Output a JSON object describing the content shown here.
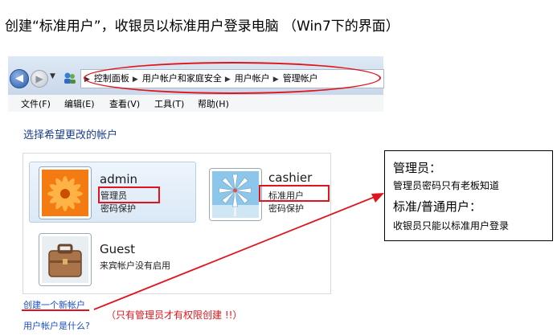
{
  "title": "创建“标准用户”，收银员以标准用户登录电脑 （Win7下的界面）",
  "address_bar": {
    "breadcrumbs": [
      "控制面板",
      "用户帐户和家庭安全",
      "用户帐户",
      "管理帐户"
    ]
  },
  "menu": [
    "文件(F)",
    "编辑(E)",
    "查看(V)",
    "工具(T)",
    "帮助(H)"
  ],
  "prompt": "选择希望更改的帐户",
  "accounts": [
    {
      "name": "admin",
      "role": "管理员",
      "password": "密码保护"
    },
    {
      "name": "cashier",
      "role": "标准用户",
      "password": "密码保护"
    },
    {
      "name": "Guest",
      "role": "来宾帐户没有启用"
    }
  ],
  "links": {
    "create": "创建一个新帐户",
    "what": "用户帐户是什么?"
  },
  "annotation_note": "（只有管理员才有权限创建 !!）",
  "callout": {
    "admin_title": "管理员：",
    "admin_desc": "管理员密码只有老板知道",
    "std_title": "标准/普通用户：",
    "std_desc": "收银员只能以标准用户登录"
  },
  "colors": {
    "annotation_red": "#e0141b",
    "link_blue": "#1a4fc4"
  }
}
